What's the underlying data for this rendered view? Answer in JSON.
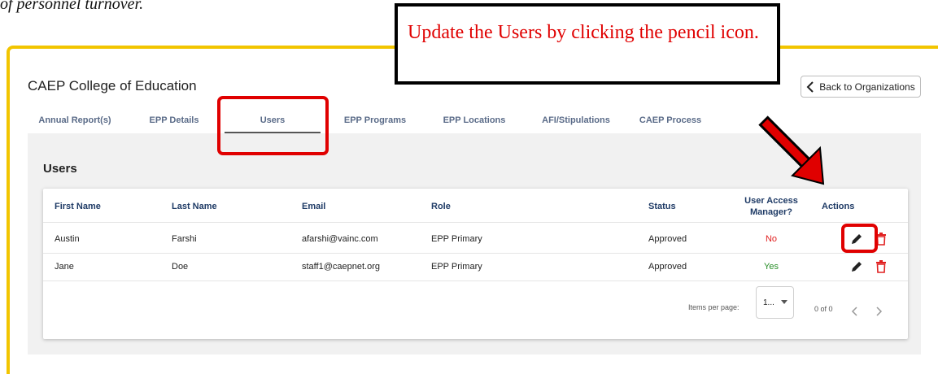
{
  "document": {
    "caption": "of personnel turnover."
  },
  "annotation": {
    "callout_text": "Update the Users by clicking the pencil icon."
  },
  "header": {
    "org_title": "CAEP College of Education",
    "back_label": "Back to Organizations"
  },
  "tabs": [
    {
      "label": "Annual Report(s)"
    },
    {
      "label": "EPP Details"
    },
    {
      "label": "Users",
      "active": true
    },
    {
      "label": "EPP Programs"
    },
    {
      "label": "EPP Locations"
    },
    {
      "label": "AFI/Stipulations"
    },
    {
      "label": "CAEP Process"
    }
  ],
  "section": {
    "title": "Users"
  },
  "table": {
    "columns": [
      "First Name",
      "Last Name",
      "Email",
      "Role",
      "Status",
      "User Access Manager?",
      "Actions"
    ],
    "rows": [
      {
        "first": "Austin",
        "last": "Farshi",
        "email": "afarshi@vainc.com",
        "role": "EPP Primary",
        "status": "Approved",
        "uam": "No"
      },
      {
        "first": "Jane",
        "last": "Doe",
        "email": "staff1@caepnet.org",
        "role": "EPP Primary",
        "status": "Approved",
        "uam": "Yes"
      }
    ]
  },
  "pagination": {
    "items_per_page_label": "Items per page:",
    "items_per_page_value": "1...",
    "range_label": "0 of 0"
  },
  "icons": {
    "back": "chevron-left-icon",
    "edit": "pencil-icon",
    "delete": "trash-icon",
    "prev": "chevron-left-icon",
    "next": "chevron-right-icon",
    "dropdown": "caret-down-icon"
  },
  "colors": {
    "frame_accent": "#f2c500",
    "highlight": "#e00000",
    "header_text": "#1f3b66",
    "tab_text": "#5a6b88",
    "status_no": "#e02020",
    "status_yes": "#2a8f2a"
  }
}
